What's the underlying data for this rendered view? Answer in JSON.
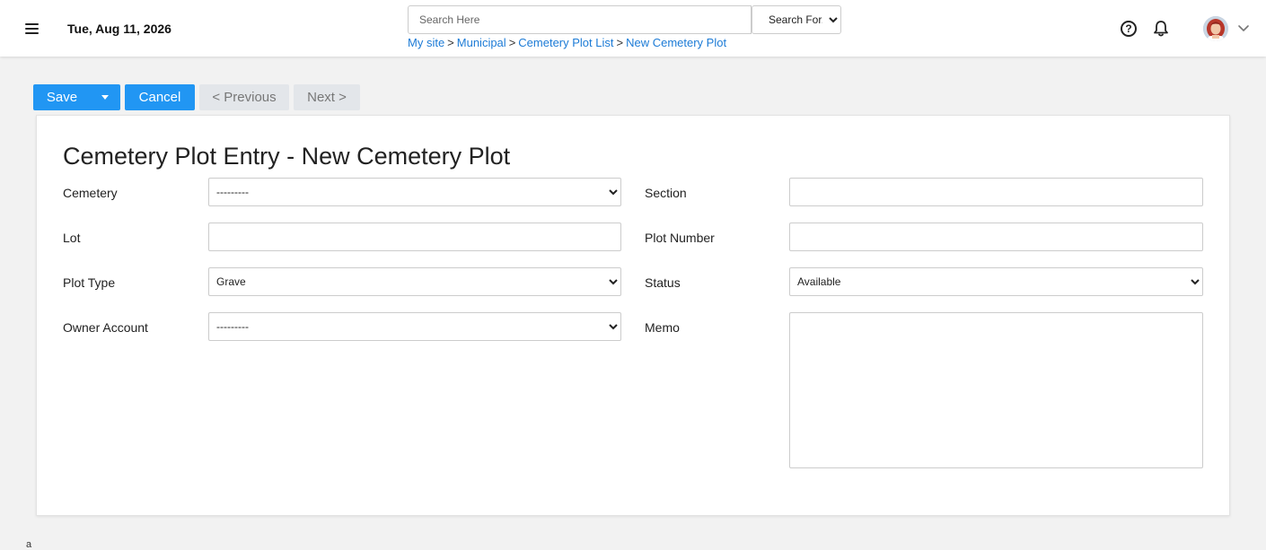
{
  "header": {
    "date": "Tue, Aug 11, 2026",
    "search_placeholder": "Search Here",
    "search_for_label": "Search For...",
    "breadcrumb": [
      "My site",
      "Municipal",
      "Cemetery Plot List",
      "New Cemetery Plot"
    ],
    "breadcrumb_separator": ">",
    "help_icon": "question-circle-icon",
    "notification_icon": "bell-icon",
    "user_menu_icon": "chevron-down-icon"
  },
  "toolbar": {
    "save_label": "Save",
    "cancel_label": "Cancel",
    "previous_label": "< Previous",
    "next_label": "Next >"
  },
  "form": {
    "title": "Cemetery Plot Entry - New Cemetery Plot",
    "cemetery_label": "Cemetery",
    "cemetery_value": "---------",
    "section_label": "Section",
    "section_value": "",
    "lot_label": "Lot",
    "lot_value": "",
    "plot_number_label": "Plot Number",
    "plot_number_value": "",
    "plot_type_label": "Plot Type",
    "plot_type_value": "Grave",
    "status_label": "Status",
    "status_value": "Available",
    "owner_account_label": "Owner Account",
    "owner_account_value": "---------",
    "memo_label": "Memo",
    "memo_value": ""
  },
  "footer_mark": "a",
  "colors": {
    "primary": "#2196f3",
    "link": "#1c7bd6",
    "disabled_button": "#e3e6ea",
    "background": "#f2f2f2"
  }
}
